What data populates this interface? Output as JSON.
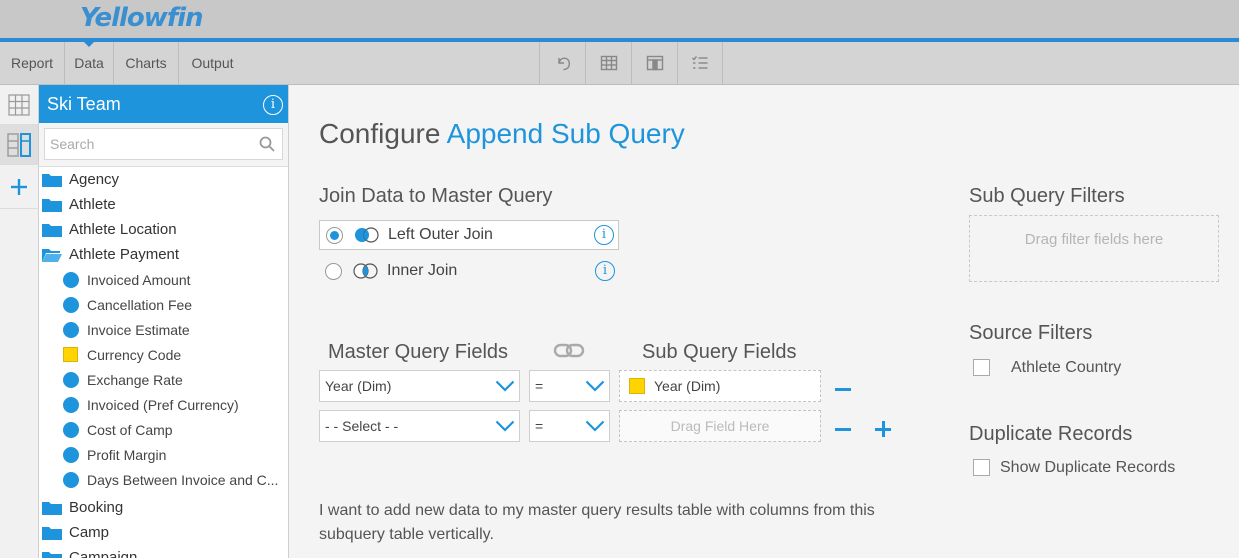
{
  "app": {
    "logo_text": "Yellowfin"
  },
  "nav": {
    "tabs": [
      {
        "label": "Report"
      },
      {
        "label": "Data"
      },
      {
        "label": "Charts"
      },
      {
        "label": "Output"
      }
    ],
    "active_tab": "Data",
    "tools": [
      "undo-icon",
      "table-view-icon",
      "table-columns-icon",
      "list-checks-icon"
    ]
  },
  "strip": {
    "icons": [
      "grid-icon",
      "columns-panel-icon",
      "add-icon"
    ]
  },
  "panel": {
    "title": "Ski Team",
    "search_placeholder": "Search",
    "folders_top": [
      "Agency",
      "Athlete",
      "Athlete Location",
      "Athlete Payment"
    ],
    "fields": [
      {
        "label": "Invoiced Amount",
        "kind": "metric"
      },
      {
        "label": "Cancellation Fee",
        "kind": "metric"
      },
      {
        "label": "Invoice Estimate",
        "kind": "metric"
      },
      {
        "label": "Currency Code",
        "kind": "dimension"
      },
      {
        "label": "Exchange Rate",
        "kind": "metric"
      },
      {
        "label": "Invoiced (Pref Currency)",
        "kind": "metric"
      },
      {
        "label": "Cost of Camp",
        "kind": "metric"
      },
      {
        "label": "Profit Margin",
        "kind": "metric"
      },
      {
        "label": "Days Between Invoice and C...",
        "kind": "metric"
      }
    ],
    "folders_bottom": [
      "Booking",
      "Camp",
      "Campaign"
    ]
  },
  "main": {
    "title_prefix": "Configure",
    "title_accent": "Append Sub Query",
    "join_heading": "Join Data to Master Query",
    "join_options": [
      {
        "label": "Left Outer Join",
        "selected": true
      },
      {
        "label": "Inner Join",
        "selected": false
      }
    ],
    "master_fields_heading": "Master Query Fields",
    "sub_fields_heading": "Sub Query Fields",
    "rows": [
      {
        "master": "Year (Dim)",
        "operator": "=",
        "sub": "Year (Dim)"
      },
      {
        "master": "- - Select - -",
        "operator": "=",
        "sub_placeholder": "Drag Field Here"
      }
    ],
    "description": "I want to add new data to my master query results table with columns from this subquery table vertically."
  },
  "right": {
    "sub_filters_heading": "Sub Query Filters",
    "sub_filters_placeholder": "Drag filter fields here",
    "source_filters_heading": "Source Filters",
    "source_filter_item": "Athlete Country",
    "duplicates_heading": "Duplicate Records",
    "duplicates_option": "Show Duplicate Records"
  },
  "colors": {
    "accent": "#1e94dc",
    "dimension": "#ffd400",
    "header_bg": "#c8c8c8"
  }
}
